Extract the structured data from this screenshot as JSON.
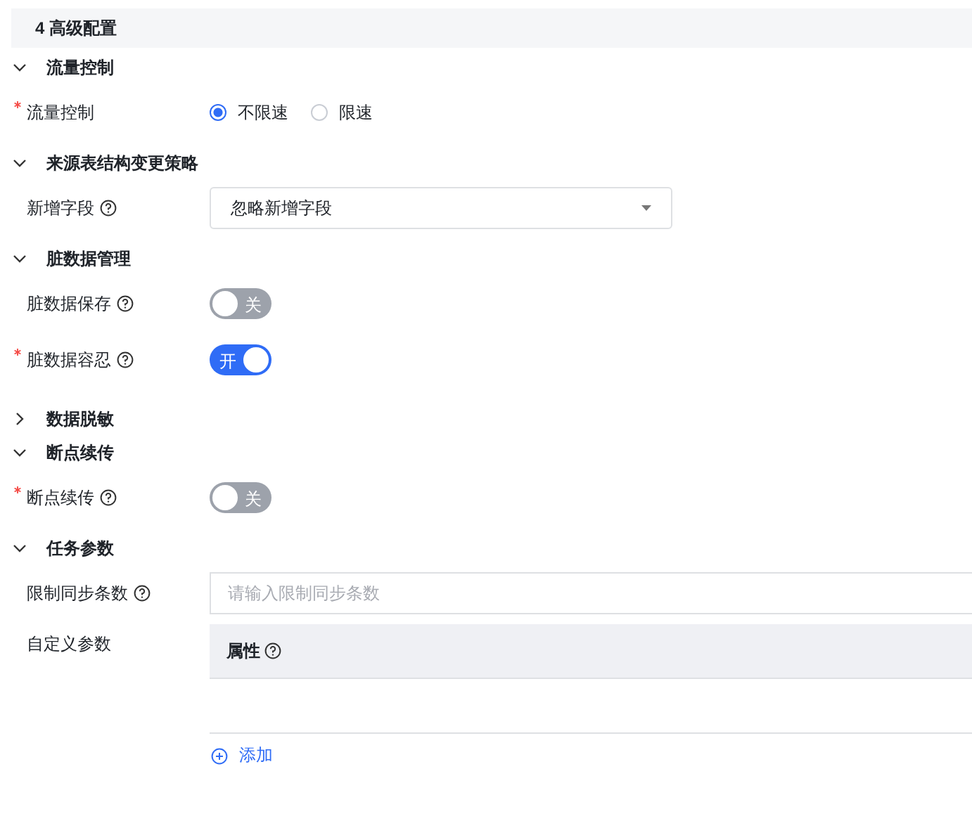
{
  "title": "4 高级配置",
  "sections": [
    {
      "heading": "流量控制",
      "expanded": true,
      "fields": [
        {
          "kind": "radio",
          "label": "流量控制",
          "required": true,
          "help": false,
          "options": [
            {
              "label": "不限速",
              "selected": true
            },
            {
              "label": "限速",
              "selected": false
            }
          ]
        }
      ]
    },
    {
      "heading": "来源表结构变更策略",
      "expanded": true,
      "fields": [
        {
          "kind": "select",
          "label": "新增字段",
          "required": false,
          "help": true,
          "value": "忽略新增字段"
        }
      ]
    },
    {
      "heading": "脏数据管理",
      "expanded": true,
      "fields": [
        {
          "kind": "switch",
          "label": "脏数据保存",
          "required": false,
          "help": true,
          "on": false,
          "text": "关"
        },
        {
          "kind": "switch",
          "label": "脏数据容忍",
          "required": true,
          "help": true,
          "on": true,
          "text": "开"
        }
      ]
    },
    {
      "heading": "数据脱敏",
      "expanded": false
    },
    {
      "heading": "断点续传",
      "expanded": true,
      "fields": [
        {
          "kind": "switch",
          "label": "断点续传",
          "required": true,
          "help": true,
          "on": false,
          "text": "关"
        }
      ]
    },
    {
      "heading": "任务参数",
      "expanded": true,
      "fields": [
        {
          "kind": "input",
          "label": "限制同步条数",
          "required": false,
          "help": true,
          "placeholder": "请输入限制同步条数"
        },
        {
          "kind": "table",
          "label": "自定义参数",
          "required": false,
          "help": false,
          "columns": [
            {
              "label": "属性",
              "help": true
            }
          ],
          "add": "添加"
        }
      ]
    }
  ]
}
